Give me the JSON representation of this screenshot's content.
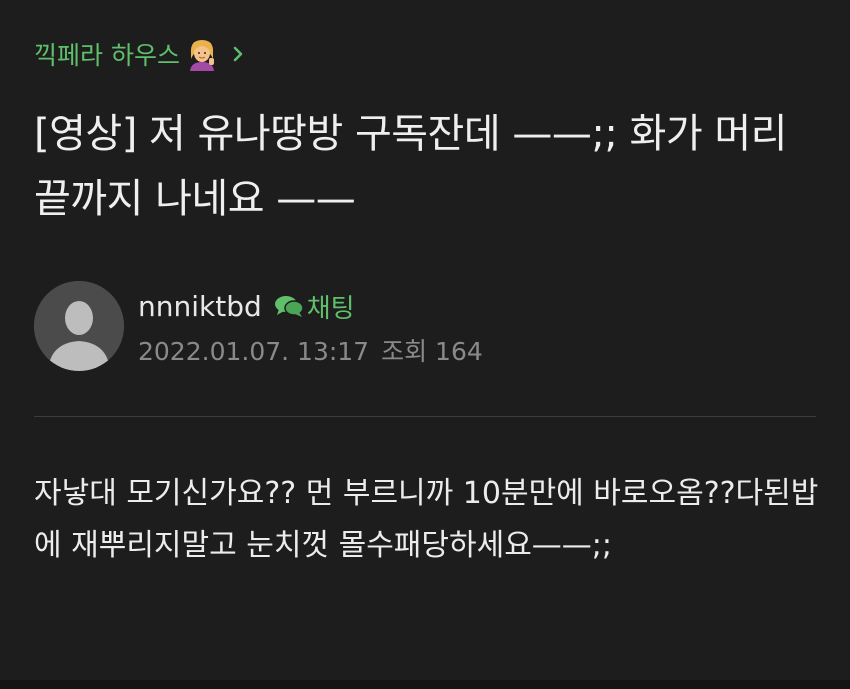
{
  "cafe": {
    "name": "끽페라 하우스",
    "emoji": "person-tipping-hand-emoji"
  },
  "post": {
    "title": "[영상] 저 유나땅방 구독잔데 ——;; 화가 머리 끝까지 나네요 ——",
    "author": "nnniktbd",
    "chat_label": "채팅",
    "date": "2022.01.07. 13:17",
    "views_label": "조회 164",
    "body": "자낳대 모기신가요?? 먼 부르니까 10분만에 바로오옴??다된밥에 재뿌리지말고 눈치껏 몰수패당하세요——;;"
  },
  "colors": {
    "background": "#1d1d1d",
    "accent_green": "#5fbf6a",
    "text": "#e8e8e8",
    "muted": "#8a8a8a",
    "divider": "#3c3c3c"
  },
  "icons": {
    "cafe_chevron": "chevron-right-icon",
    "chat": "chat-bubbles-icon",
    "avatar": "default-avatar-icon"
  }
}
